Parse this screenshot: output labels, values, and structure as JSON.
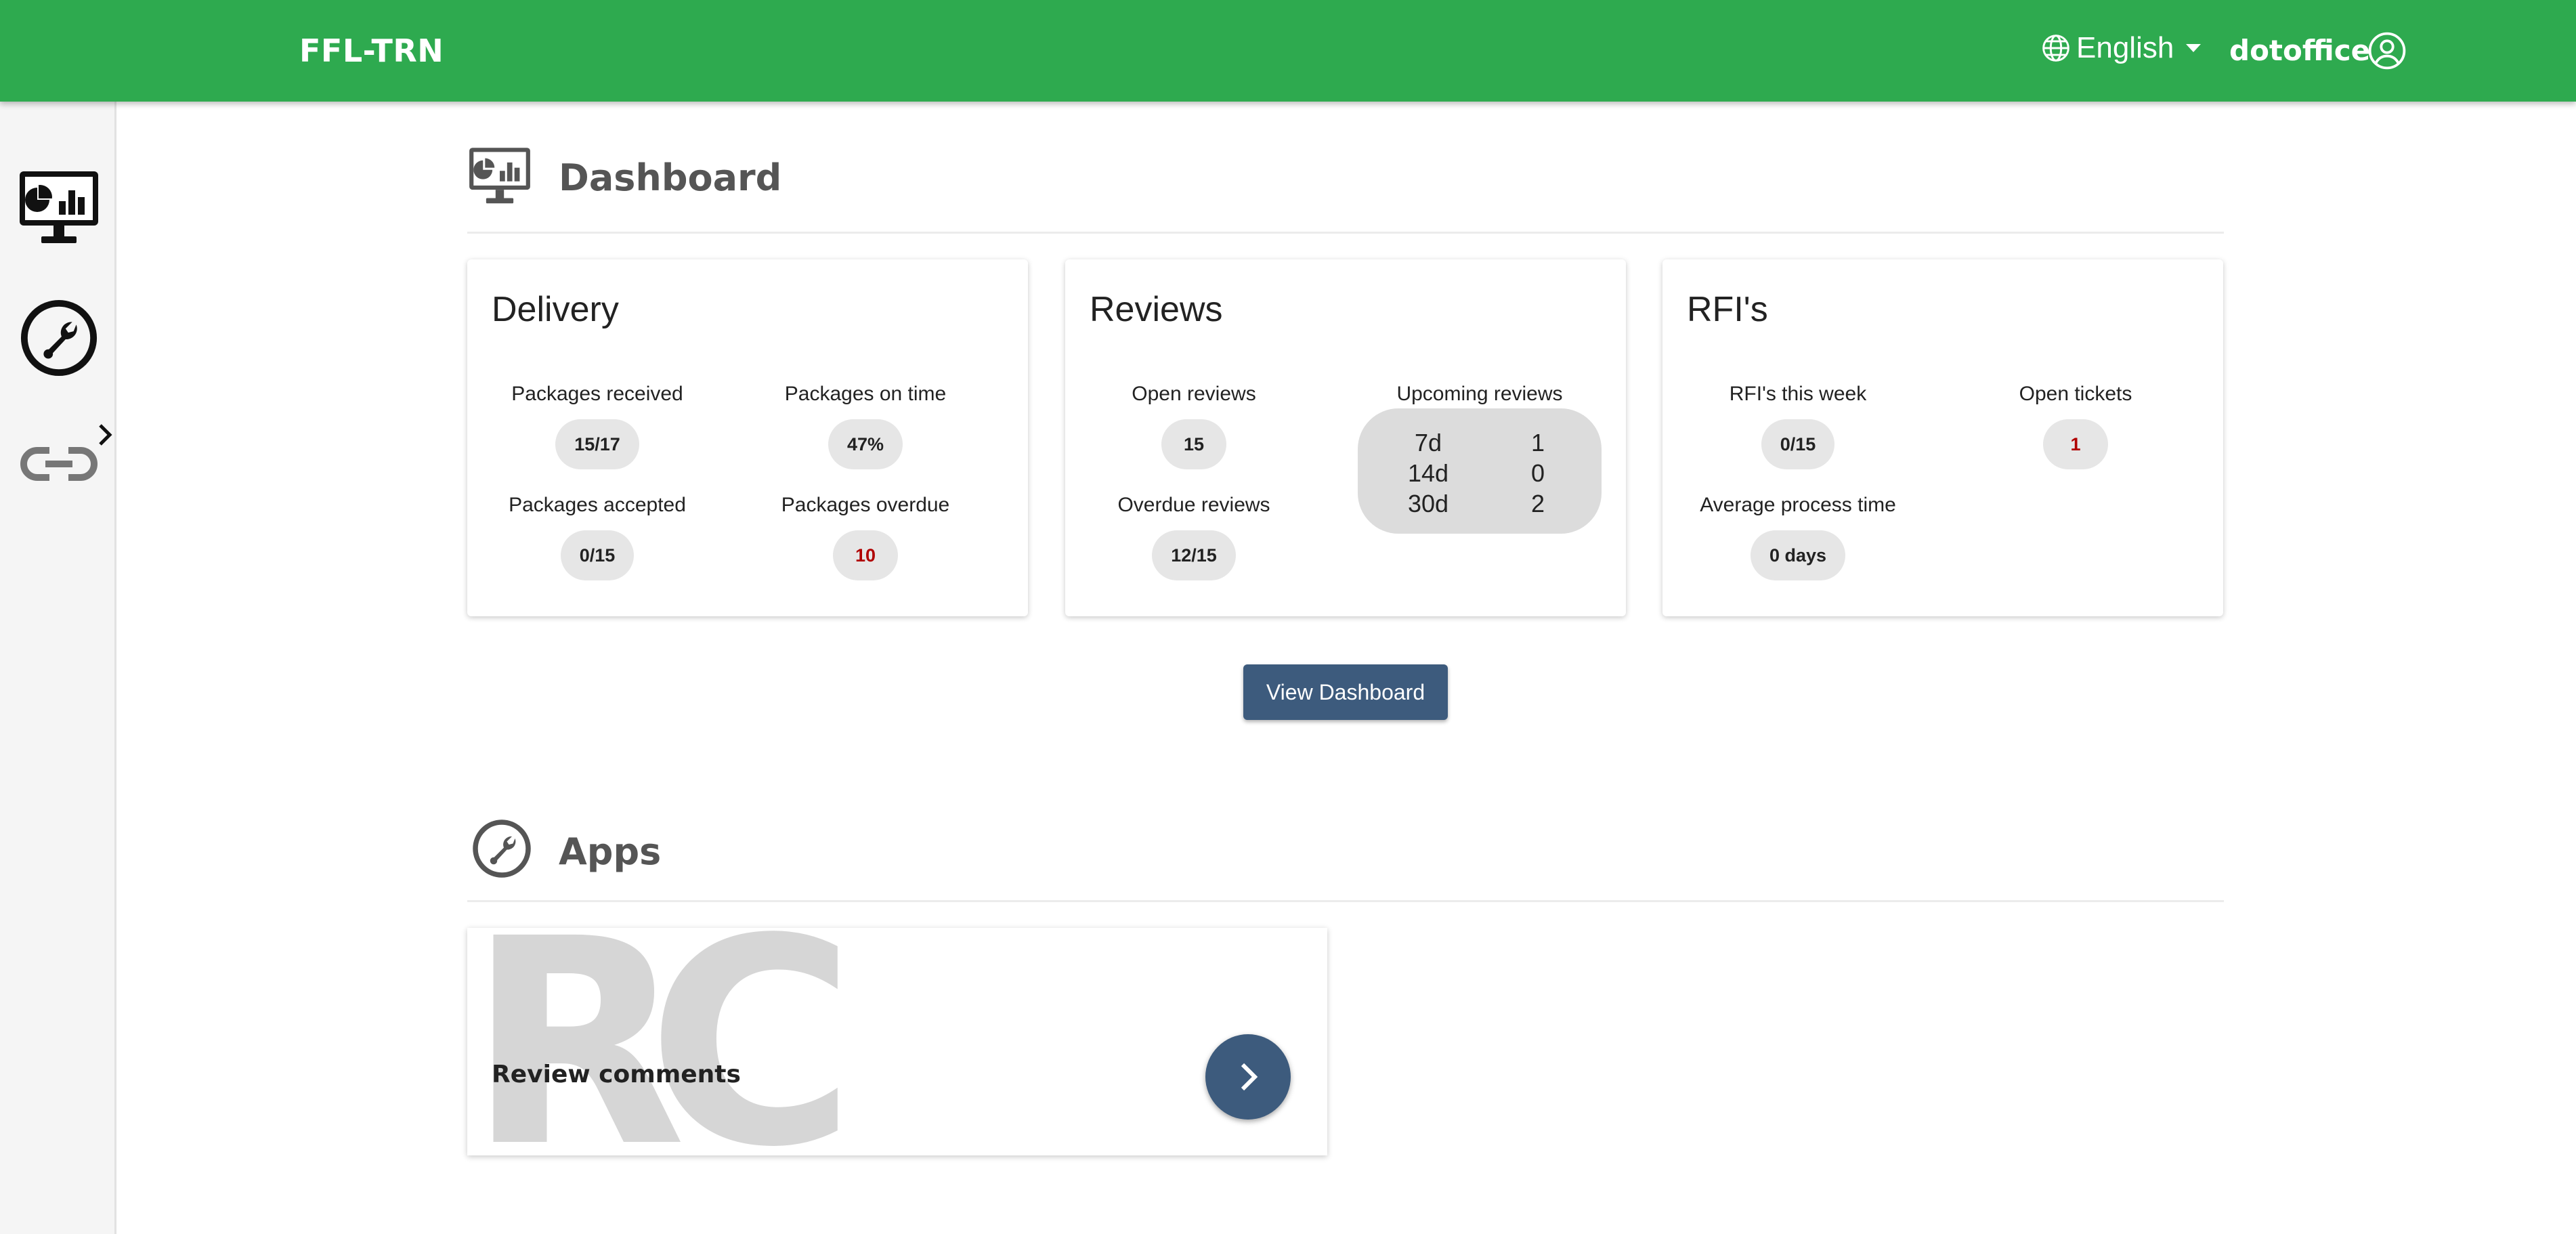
{
  "header": {
    "brand": "FFL-TRN",
    "language": "English",
    "username": "dotoffice",
    "accent_color": "#2eaa4f"
  },
  "sidebar": {
    "items": [
      {
        "name": "dashboard",
        "icon": "monitor-chart-icon"
      },
      {
        "name": "apps",
        "icon": "wrench-icon",
        "expandable": true
      },
      {
        "name": "links",
        "icon": "link-icon"
      }
    ]
  },
  "dashboard": {
    "title": "Dashboard",
    "cards": {
      "delivery": {
        "title": "Delivery",
        "stats": [
          {
            "label": "Packages received",
            "value": "15/17",
            "alert": false
          },
          {
            "label": "Packages on time",
            "value": "47%",
            "alert": false
          },
          {
            "label": "Packages accepted",
            "value": "0/15",
            "alert": false
          },
          {
            "label": "Packages overdue",
            "value": "10",
            "alert": true
          }
        ]
      },
      "reviews": {
        "title": "Reviews",
        "open_label": "Open reviews",
        "open_value": "15",
        "overdue_label": "Overdue reviews",
        "overdue_value": "12/15",
        "upcoming_label": "Upcoming reviews",
        "upcoming": [
          {
            "period": "7d",
            "count": "1"
          },
          {
            "period": "14d",
            "count": "0"
          },
          {
            "period": "30d",
            "count": "2"
          }
        ]
      },
      "rfis": {
        "title": "RFI's",
        "week_label": "RFI's this week",
        "week_value": "0/15",
        "tickets_label": "Open tickets",
        "tickets_value": "1",
        "process_label": "Average process time",
        "process_value": "0 days"
      }
    },
    "view_button": "View Dashboard"
  },
  "apps": {
    "title": "Apps",
    "items": [
      {
        "name": "Review comments",
        "abbr": "RC"
      }
    ]
  }
}
